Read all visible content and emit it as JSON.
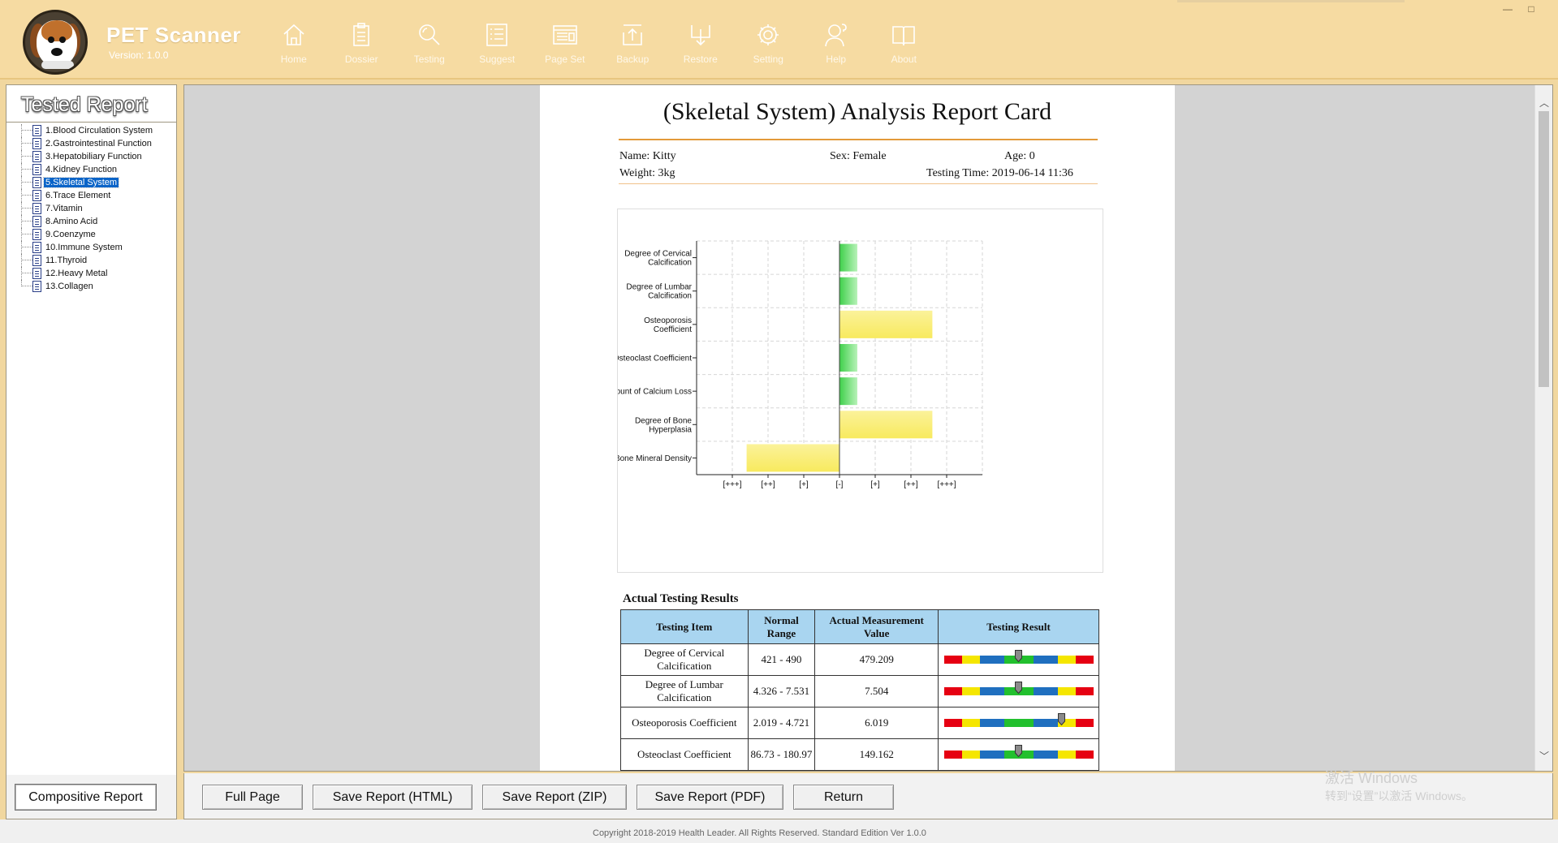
{
  "app": {
    "title": "PET Scanner",
    "version": "Version: 1.0.0"
  },
  "toolbar": {
    "items": [
      {
        "label": "Home",
        "icon": "home-icon"
      },
      {
        "label": "Dossier",
        "icon": "clipboard-icon"
      },
      {
        "label": "Testing",
        "icon": "magnifier-icon"
      },
      {
        "label": "Suggest",
        "icon": "list-icon"
      },
      {
        "label": "Page Set",
        "icon": "page-layout-icon"
      },
      {
        "label": "Backup",
        "icon": "upload-icon"
      },
      {
        "label": "Restore",
        "icon": "download-icon"
      },
      {
        "label": "Setting",
        "icon": "gear-icon"
      },
      {
        "label": "Help",
        "icon": "user-help-icon"
      },
      {
        "label": "About",
        "icon": "book-icon"
      }
    ]
  },
  "window_controls": {
    "minimize": "—",
    "maximize": "□"
  },
  "sidebar": {
    "title": "Tested Report",
    "items": [
      "1.Blood Circulation System",
      "2.Gastrointestinal Function",
      "3.Hepatobiliary Function",
      "4.Kidney Function",
      "5.Skeletal System",
      "6.Trace Element",
      "7.Vitamin",
      "8.Amino Acid",
      "9.Coenzyme",
      "10.Immune System",
      "11.Thyroid",
      "12.Heavy Metal",
      "13.Collagen"
    ],
    "selected_index": 4,
    "composite_button": "Compositive Report"
  },
  "report": {
    "title": "(Skeletal System) Analysis Report Card",
    "name": "Name: Kitty",
    "sex": "Sex: Female",
    "age": "Age: 0",
    "weight": "Weight: 3kg",
    "testing_time": "Testing Time: 2019-06-14 11:36",
    "results_title": "Actual Testing Results",
    "table_headers": {
      "item": "Testing Item",
      "range": "Normal Range",
      "value": "Actual Measurement Value",
      "result": "Testing Result"
    },
    "rows": [
      {
        "item": "Degree of Cervical Calcification",
        "range": "421 - 490",
        "value": "479.209",
        "marker": 0.5
      },
      {
        "item": "Degree of Lumbar Calcification",
        "range": "4.326 - 7.531",
        "value": "7.504",
        "marker": 0.5
      },
      {
        "item": "Osteoporosis Coefficient",
        "range": "2.019 - 4.721",
        "value": "6.019",
        "marker": 0.79
      },
      {
        "item": "Osteoclast Coefficient",
        "range": "86.73 - 180.97",
        "value": "149.162",
        "marker": 0.5
      }
    ],
    "bar_colors": {
      "red": "#e60012",
      "yellow": "#f5e600",
      "blue": "#1f6fbf",
      "green": "#22c02e"
    }
  },
  "chart_data": {
    "type": "bar",
    "orientation": "horizontal",
    "categories": [
      "Degree of Cervical Calcification",
      "Degree of Lumbar Calcification",
      "Osteoporosis Coefficient",
      "Osteoclast Coefficient",
      "Amount of Calcium Loss",
      "Degree of Bone Hyperplasia",
      "Bone Mineral Density"
    ],
    "values": [
      0.5,
      0.5,
      2.6,
      0.5,
      0.5,
      2.6,
      -2.6
    ],
    "colors": [
      "green",
      "green",
      "yellow",
      "green",
      "green",
      "yellow",
      "yellow"
    ],
    "x_ticks": [
      "[+++]",
      "[++]",
      "[+]",
      "[-]",
      "[+]",
      "[++]",
      "[+++]"
    ],
    "xlim": [
      -4,
      4
    ],
    "grid": true
  },
  "bottom_buttons": {
    "full_page": "Full Page",
    "save_html": "Save Report (HTML)",
    "save_zip": "Save Report (ZIP)",
    "save_pdf": "Save Report (PDF)",
    "return": "Return"
  },
  "watermark": {
    "line1": "激活 Windows",
    "line2": "转到“设置”以激活 Windows。"
  },
  "footer": "Copyright 2018-2019 Health Leader. All Rights Reserved.  Standard Edition Ver 1.0.0"
}
